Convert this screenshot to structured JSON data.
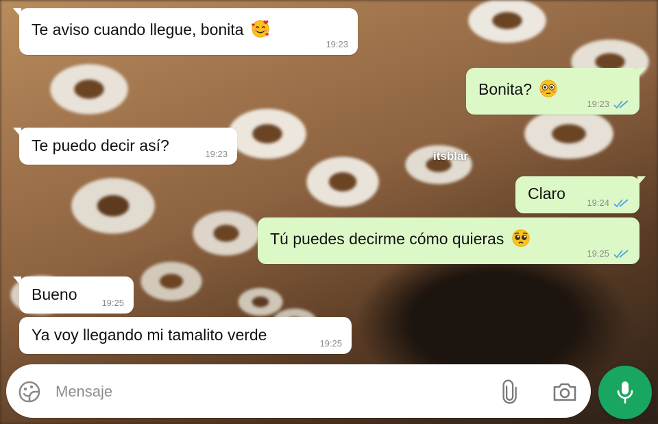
{
  "watermark": "itsblar",
  "messages": [
    {
      "text": "Te aviso cuando llegue, bonita",
      "emoji": "smiling-face-with-hearts",
      "time": "19:23",
      "dir": "in"
    },
    {
      "text": "Bonita?",
      "emoji": "flushed-face",
      "time": "19:23",
      "dir": "out",
      "status": "read"
    },
    {
      "text": "Te puedo decir así?",
      "time": "19:23",
      "dir": "in"
    },
    {
      "text": "Claro",
      "time": "19:24",
      "dir": "out",
      "status": "read"
    },
    {
      "text": "Tú puedes decirme cómo quieras",
      "emoji": "pleading-face",
      "time": "19:25",
      "dir": "out",
      "status": "read"
    },
    {
      "text": "Bueno",
      "time": "19:25",
      "dir": "in"
    },
    {
      "text": "Ya voy llegando mi tamalito verde",
      "time": "19:25",
      "dir": "in"
    }
  ],
  "composer": {
    "placeholder": "Mensaje",
    "icons": [
      "sticker-icon",
      "attach-icon",
      "camera-icon",
      "mic-icon"
    ]
  },
  "colors": {
    "incoming_bubble": "#ffffff",
    "outgoing_bubble": "#dcf8c6",
    "read_ticks": "#4fa3e0",
    "mic_button": "#19a661"
  }
}
